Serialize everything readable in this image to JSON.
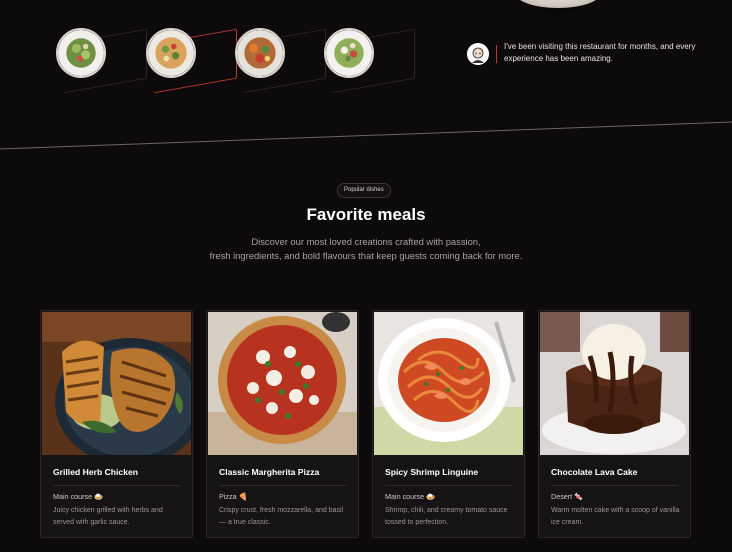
{
  "thumbnails": [
    {
      "name": "salad-thumbnail-1",
      "active": false
    },
    {
      "name": "pasta-thumbnail",
      "active": true
    },
    {
      "name": "veggie-bowl-thumbnail",
      "active": false
    },
    {
      "name": "salad-thumbnail-2",
      "active": false
    }
  ],
  "testimonial": {
    "text": "I've been visiting this restaurant for months, and every experience has been amazing."
  },
  "section": {
    "tag": "Popular dishes",
    "title": "Favorite meals",
    "desc_line1": "Discover our most loved creations crafted with passion,",
    "desc_line2": "fresh ingredients, and bold flavours that keep guests coming back for more."
  },
  "cards": [
    {
      "title": "Grilled Herb Chicken",
      "category": "Main course 🍛",
      "description": "Juicy chicken grilled with herbs and served with garlic sauce."
    },
    {
      "title": "Classic Margherita Pizza",
      "category": "Pizza 🍕",
      "description": "Crispy crust, fresh mozzarella, and basil — a true classic."
    },
    {
      "title": "Spicy Shrimp Linguine",
      "category": "Main course 🍛",
      "description": "Shrimp, chili, and creamy tomato sauce tossed to perfection."
    },
    {
      "title": "Chocolate Lava Cake",
      "category": "Desert 🍬",
      "description": "Warm molten cake with a scoop of vanilla ice cream."
    }
  ],
  "colors": {
    "background": "#0d0a0b",
    "accent": "#c0392b",
    "card": "#161314"
  }
}
